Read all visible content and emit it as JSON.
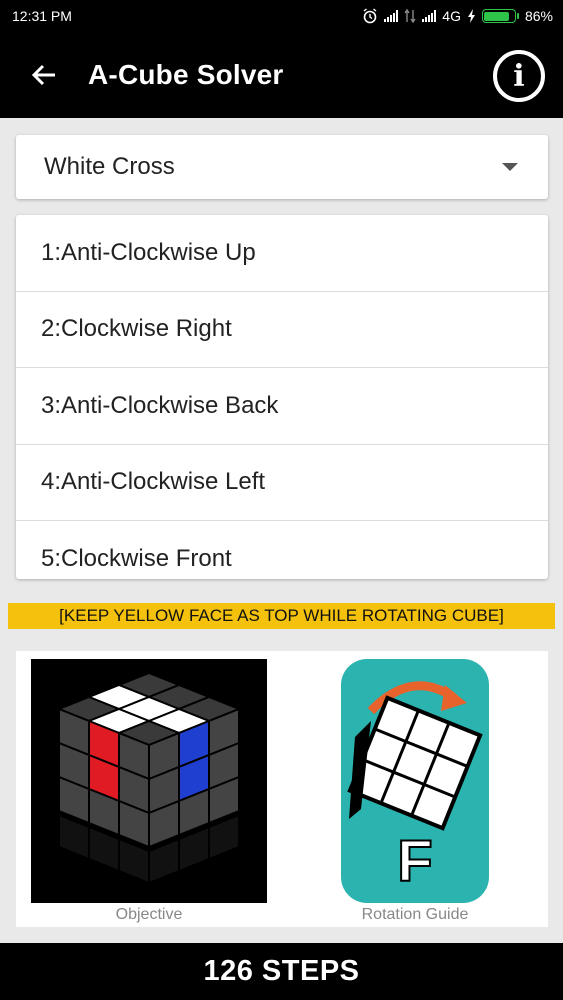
{
  "status_bar": {
    "time": "12:31 PM",
    "network": "4G",
    "battery": "86%",
    "battery_level": 0.86,
    "icons": [
      "alarm-icon",
      "signal-icon",
      "data-transfer-icon",
      "signal-icon",
      "charging-icon",
      "battery-icon"
    ]
  },
  "app_bar": {
    "title": "A-Cube Solver",
    "back_icon": "arrow-left-icon",
    "info_icon": "info-icon",
    "info_glyph": "i"
  },
  "stage_select": {
    "selected": "White Cross"
  },
  "steps": [
    {
      "label": "1:Anti-Clockwise Up"
    },
    {
      "label": "2:Clockwise Right"
    },
    {
      "label": "3:Anti-Clockwise Back"
    },
    {
      "label": "4:Anti-Clockwise Left"
    },
    {
      "label": "5:Clockwise Front"
    }
  ],
  "banner": {
    "text": "[KEEP YELLOW FACE AS TOP WHILE ROTATING CUBE]"
  },
  "images": {
    "objective_caption": "Objective",
    "rotation_caption": "Rotation Guide",
    "rotation_letter": "F"
  },
  "footer": {
    "steps_text": "126 STEPS"
  },
  "colors": {
    "banner_yellow": "#f4c20d",
    "guide_teal": "#2bb3b0",
    "battery_green": "#2ec44a",
    "cube_red": "#e01b24",
    "cube_blue": "#1f3fd0",
    "arrow_orange": "#e8632b"
  }
}
